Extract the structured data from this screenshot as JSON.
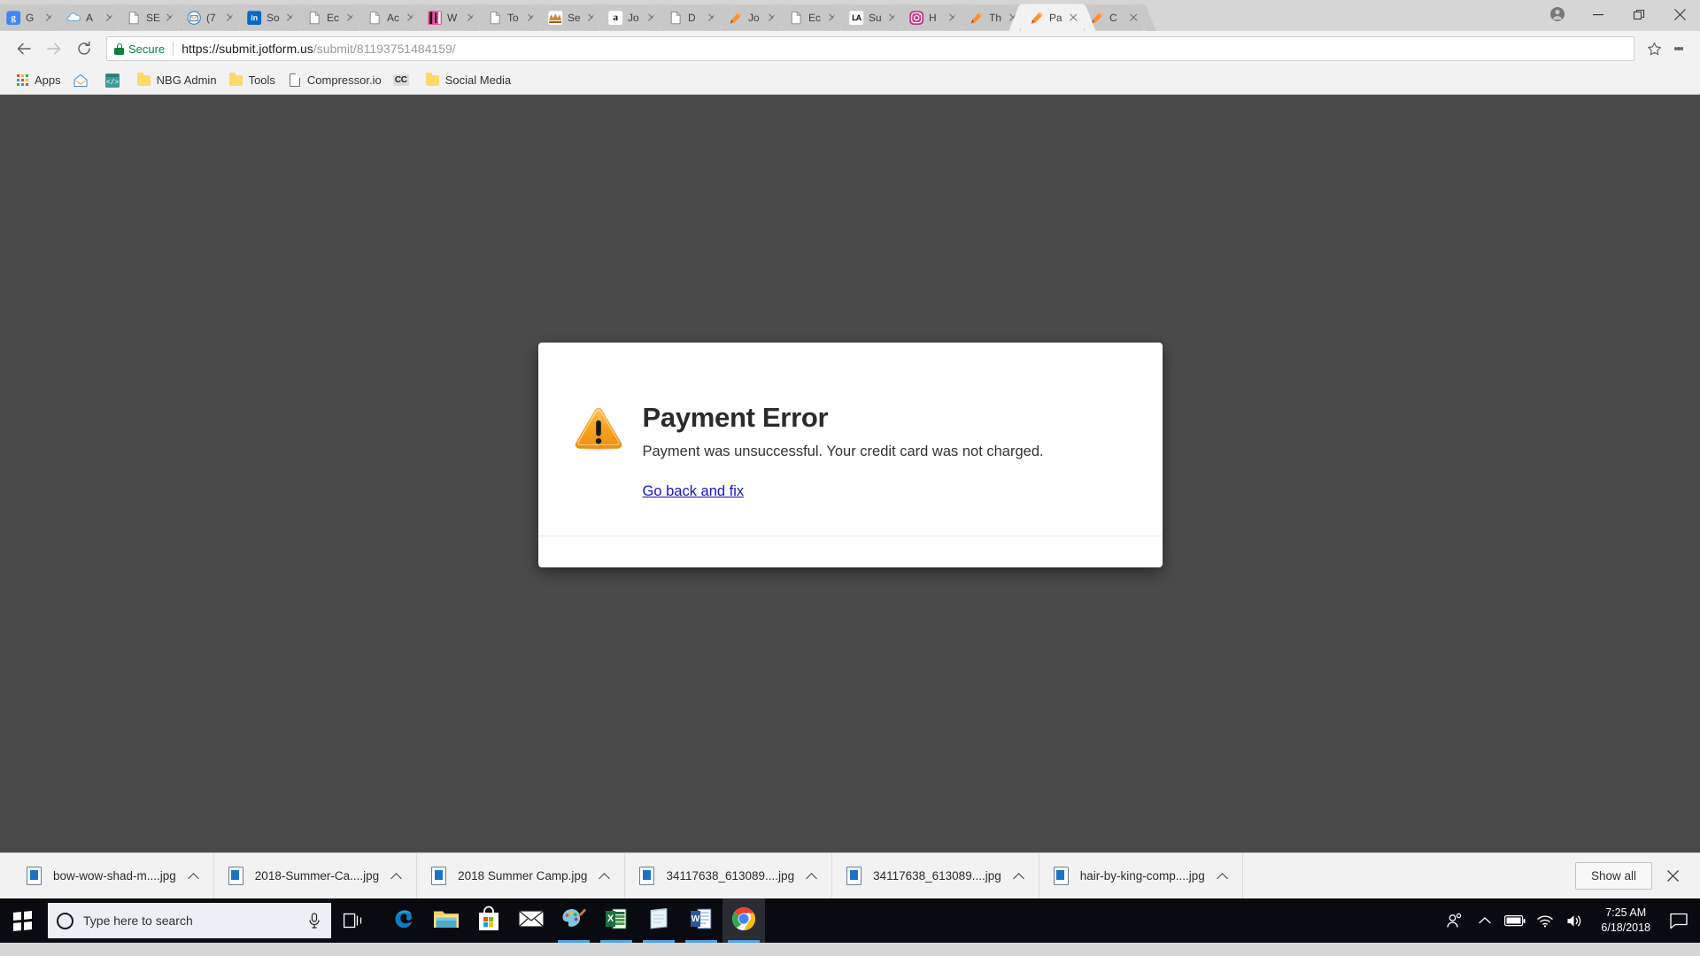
{
  "browser": {
    "tabs": [
      {
        "title": "G",
        "favicon": "google-b-icon",
        "favicon_color": "#4285f4",
        "favicon_text": "g",
        "active": false
      },
      {
        "title": "A",
        "favicon": "cloud-icon",
        "favicon_color": "#ffffff",
        "favicon_text": "",
        "active": false
      },
      {
        "title": "SE",
        "favicon": "page-icon",
        "favicon_color": "#ffffff",
        "favicon_text": "",
        "active": false
      },
      {
        "title": "(7",
        "favicon": "mail-icon",
        "favicon_color": "#ffffff",
        "favicon_text": "",
        "active": false
      },
      {
        "title": "So",
        "favicon": "linkedin-icon",
        "favicon_color": "#0a66c2",
        "favicon_text": "in",
        "active": false
      },
      {
        "title": "Ec",
        "favicon": "page-icon",
        "favicon_color": "#ffffff",
        "favicon_text": "",
        "active": false
      },
      {
        "title": "Ac",
        "favicon": "page-icon",
        "favicon_color": "#ffffff",
        "favicon_text": "",
        "active": false
      },
      {
        "title": "W",
        "favicon": "pink-image-icon",
        "favicon_color": "#e8318f",
        "favicon_text": "",
        "active": false
      },
      {
        "title": "To",
        "favicon": "page-icon",
        "favicon_color": "#ffffff",
        "favicon_text": "",
        "active": false
      },
      {
        "title": "Se",
        "favicon": "tiara-icon",
        "favicon_color": "#ffffff",
        "favicon_text": "",
        "active": false
      },
      {
        "title": "Jo",
        "favicon": "amazon-icon",
        "favicon_color": "#ffffff",
        "favicon_text": "a",
        "active": false
      },
      {
        "title": "D",
        "favicon": "page-icon",
        "favicon_color": "#ffffff",
        "favicon_text": "",
        "active": false
      },
      {
        "title": "Jo",
        "favicon": "jotform-pencil-icon",
        "favicon_color": "#ff6100",
        "favicon_text": "",
        "active": false
      },
      {
        "title": "Ec",
        "favicon": "page-icon",
        "favicon_color": "#ffffff",
        "favicon_text": "",
        "active": false
      },
      {
        "title": "Su",
        "favicon": "la-icon",
        "favicon_color": "#ffffff",
        "favicon_text": "LA",
        "active": false
      },
      {
        "title": "H",
        "favicon": "instagram-icon",
        "favicon_color": "#c13584",
        "favicon_text": "",
        "active": false
      },
      {
        "title": "Th",
        "favicon": "jotform-pencil-icon",
        "favicon_color": "#ff6100",
        "favicon_text": "",
        "active": false
      },
      {
        "title": "Pa",
        "favicon": "jotform-pencil-icon",
        "favicon_color": "#ff6100",
        "favicon_text": "",
        "active": true
      },
      {
        "title": "C",
        "favicon": "jotform-pencil-icon",
        "favicon_color": "#ff6100",
        "favicon_text": "",
        "active": false
      }
    ],
    "window_controls": {
      "profile": "profile-avatar-icon",
      "minimize": "minimize-icon",
      "restore": "restore-icon",
      "close": "close-icon"
    },
    "toolbar": {
      "back": "back-arrow-icon",
      "forward": "forward-arrow-icon",
      "reload": "reload-icon",
      "secure_label": "Secure",
      "url_host": "https://submit.jotform.us",
      "url_path": "/submit/81193751484159/",
      "url_full": "https://submit.jotform.us/submit/81193751484159/",
      "bookmark_star": "star-icon",
      "menu": "three-dots-menu-icon"
    },
    "bookmarks": [
      {
        "label": "Apps",
        "icon": "apps-grid-icon"
      },
      {
        "label": "",
        "icon": "home-envelope-icon"
      },
      {
        "label": "",
        "icon": "code-brackets-icon"
      },
      {
        "label": "NBG Admin",
        "icon": "folder-icon"
      },
      {
        "label": "Tools",
        "icon": "folder-icon"
      },
      {
        "label": "Compressor.io",
        "icon": "page-icon"
      },
      {
        "label": "",
        "icon": "cc-badge-icon"
      },
      {
        "label": "Social Media",
        "icon": "folder-icon"
      }
    ]
  },
  "page": {
    "background_color": "#4a4a4a",
    "dialog": {
      "icon": "warning-triangle-icon",
      "title": "Payment Error",
      "message": "Payment was unsuccessful. Your credit card was not charged.",
      "link_label": "Go back and fix",
      "link_color": "#1414c8",
      "accent_color": "#f5a11c"
    }
  },
  "downloads": {
    "items": [
      {
        "name": "bow-wow-shad-m....jpg"
      },
      {
        "name": "2018-Summer-Ca....jpg"
      },
      {
        "name": "2018 Summer Camp.jpg"
      },
      {
        "name": "34117638_613089....jpg"
      },
      {
        "name": "34117638_613089....jpg"
      },
      {
        "name": "hair-by-king-comp....jpg"
      }
    ],
    "show_all_label": "Show all",
    "close_label": "close-downloads-icon"
  },
  "taskbar": {
    "start": "windows-start-icon",
    "search_placeholder": "Type here to search",
    "cortana": "cortana-circle-icon",
    "mic": "microphone-icon",
    "task_view": "task-view-icon",
    "apps": [
      {
        "name": "microsoft-edge",
        "running": false,
        "active": false
      },
      {
        "name": "file-explorer",
        "running": false,
        "active": false
      },
      {
        "name": "microsoft-store",
        "running": false,
        "active": false
      },
      {
        "name": "mail",
        "running": false,
        "active": false
      },
      {
        "name": "paint-3d",
        "running": true,
        "active": false
      },
      {
        "name": "excel",
        "running": true,
        "active": false
      },
      {
        "name": "sticky-notes",
        "running": true,
        "active": false
      },
      {
        "name": "word",
        "running": true,
        "active": false
      },
      {
        "name": "google-chrome",
        "running": true,
        "active": true
      }
    ],
    "tray": {
      "people": "people-icon",
      "chevron": "show-hidden-icons-icon",
      "battery": "battery-icon",
      "wifi": "wifi-icon",
      "volume": "volume-icon",
      "time": "7:25 AM",
      "date": "6/18/2018",
      "action_center": "action-center-icon"
    }
  }
}
